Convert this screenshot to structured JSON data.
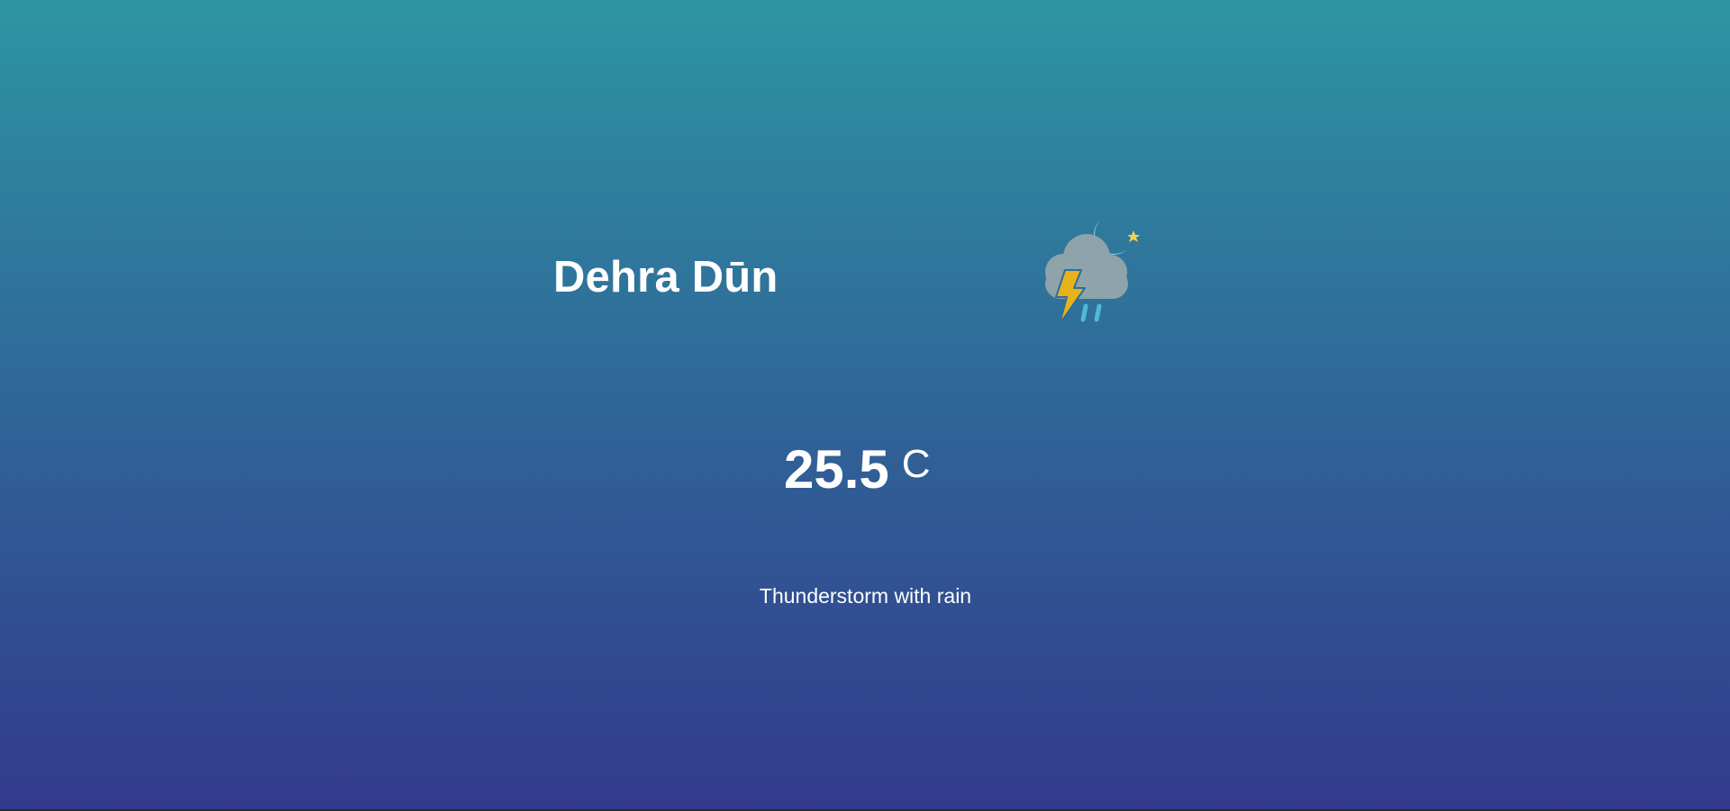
{
  "weather": {
    "city": "Dehra Dūn",
    "temperature": "25.5",
    "unit": "C",
    "description": "Thunderstorm with rain",
    "icon": "thunderstorm-night-icon"
  },
  "colors": {
    "gradient_top": "#2e95a3",
    "gradient_bottom": "#333a8d",
    "cloud": "#8fa3ab",
    "lightning": "#e8b21a",
    "rain": "#4fb9d6",
    "moon": "#7fc2d6",
    "star": "#f4d34a"
  }
}
